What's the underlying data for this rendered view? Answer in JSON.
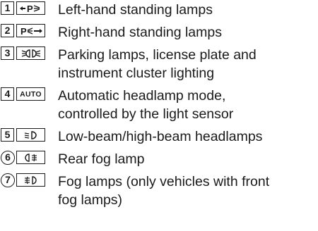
{
  "items": [
    {
      "number": "1",
      "symbol": "left-standing-lamp-icon",
      "text": "Left-hand standing lamps"
    },
    {
      "number": "2",
      "symbol": "right-standing-lamp-icon",
      "text": "Right-hand standing lamps"
    },
    {
      "number": "3",
      "symbol": "parking-lamp-icon",
      "text": "Parking lamps, license plate and\ninstrument cluster lighting"
    },
    {
      "number": "4",
      "symbol": "auto",
      "symbol_text": "AUTO",
      "text": "Automatic headlamp mode,\ncontrolled by the light sensor"
    },
    {
      "number": "5",
      "symbol": "low-beam-icon",
      "text": "Low-beam/high-beam headlamps"
    },
    {
      "number": "6",
      "symbol": "rear-fog-lamp-icon",
      "text": "Rear fog lamp"
    },
    {
      "number": "7",
      "symbol": "front-fog-lamp-icon",
      "text": "Fog lamps (only vehicles with front\nfog lamps)"
    }
  ]
}
